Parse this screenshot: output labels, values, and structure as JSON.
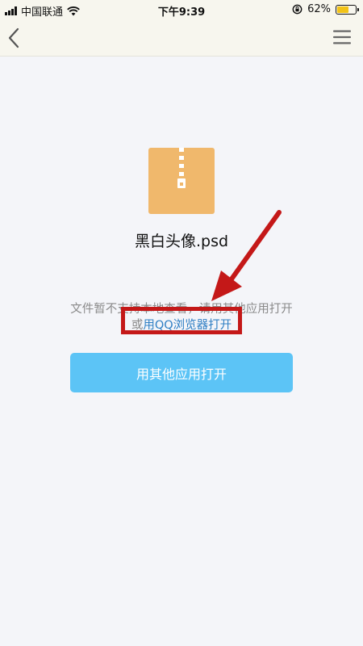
{
  "status_bar": {
    "carrier": "中国联通",
    "time": "下午9:39",
    "battery_percent": "62%",
    "battery_level": 0.62,
    "battery_color": "#f2c318"
  },
  "nav": {
    "back_icon": "chevron-left-icon",
    "menu_icon": "hamburger-menu-icon"
  },
  "file": {
    "icon": "zip-archive-icon",
    "icon_color": "#f0b86c",
    "name": "黑白头像.psd"
  },
  "hint": {
    "line1": "文件暂不支持本地查看，请用其他应用打开",
    "line2_prefix": "或",
    "qq_link": "用QQ浏览器打开"
  },
  "open_button": {
    "label": "用其他应用打开",
    "color": "#5cc4f6"
  },
  "annotation": {
    "color": "#c41818"
  }
}
